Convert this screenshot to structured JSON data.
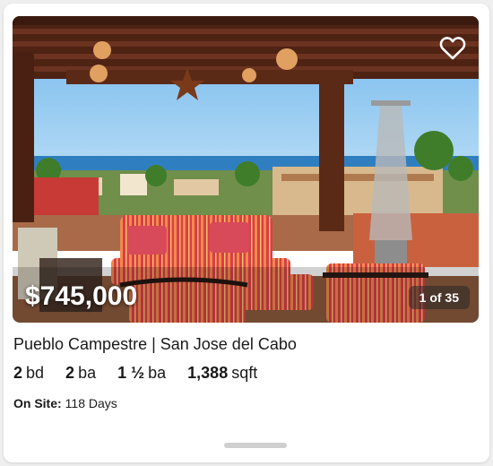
{
  "listing": {
    "price": "$745,000",
    "photo_counter": "1 of 35",
    "title": "Pueblo Campestre | San Jose del Cabo",
    "beds": {
      "value": "2",
      "unit": "bd"
    },
    "full_baths": {
      "value": "2",
      "unit": "ba"
    },
    "half_baths": {
      "value": "1 ½",
      "unit": "ba"
    },
    "area": {
      "value": "1,388",
      "unit": "sqft"
    },
    "on_site": {
      "label": "On Site:",
      "value": "118 Days"
    }
  },
  "icons": {
    "favorite": "heart-outline-icon"
  },
  "colors": {
    "sky": "#7fc3ef",
    "sea": "#2f7fc0",
    "wood": "#5b2a17",
    "cushion": "#d94450",
    "text": "#1a1a1a"
  }
}
